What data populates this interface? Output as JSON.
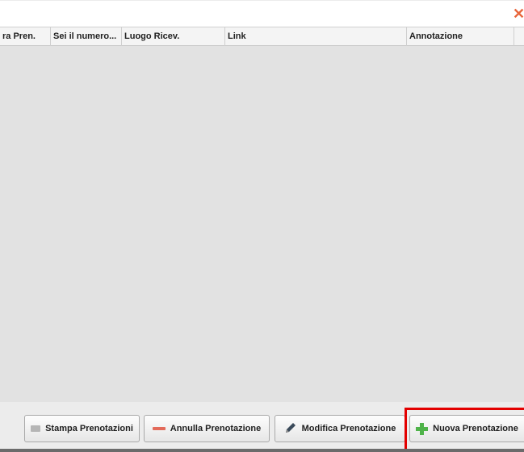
{
  "table": {
    "columns": [
      {
        "label": "ra Pren."
      },
      {
        "label": "Sei il numero..."
      },
      {
        "label": "Luogo Ricev."
      },
      {
        "label": "Link"
      },
      {
        "label": "Annotazione"
      },
      {
        "label": ""
      }
    ]
  },
  "toolbar": {
    "print_label": "Stampa Prenotazioni",
    "cancel_label": "Annulla Prenotazione",
    "edit_label": "Modifica Prenotazione",
    "new_label": "Nuova Prenotazione"
  },
  "colors": {
    "close": "#e8663c",
    "highlight": "#e30000",
    "add": "#4fb34a",
    "remove": "#e36a5a"
  },
  "icons": {
    "close": "close-icon",
    "print": "printer-icon",
    "cancel": "minus-icon",
    "edit": "pencil-icon",
    "new": "plus-icon"
  }
}
